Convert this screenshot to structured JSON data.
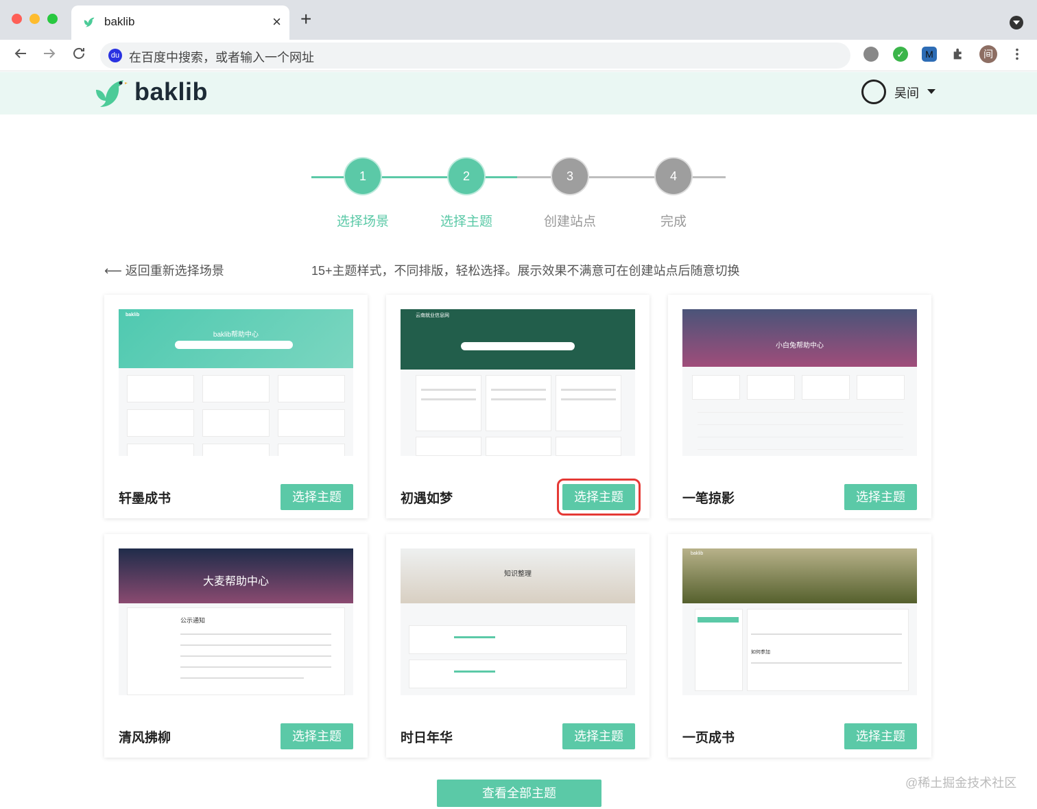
{
  "browser": {
    "tab_title": "baklib",
    "new_tab": "+",
    "close": "×",
    "omnibox_placeholder": "在百度中搜索，或者输入一个网址",
    "ext_m": "M",
    "ext_profile": "间"
  },
  "header": {
    "logo": "baklib",
    "user_name": "吴间"
  },
  "steps": [
    {
      "num": "1",
      "label": "选择场景",
      "state": "done"
    },
    {
      "num": "2",
      "label": "选择主题",
      "state": "current"
    },
    {
      "num": "3",
      "label": "创建站点",
      "state": "todo"
    },
    {
      "num": "4",
      "label": "完成",
      "state": "todo"
    }
  ],
  "back_link": "⟵ 返回重新选择场景",
  "hint": "15+主题样式，不同排版，轻松选择。展示效果不满意可在创建站点后随意切换",
  "select_label": "选择主题",
  "themes": [
    {
      "name": "轩墨成书",
      "preview_title": "baklib帮助中心",
      "preview_brand": "baklib"
    },
    {
      "name": "初遇如梦",
      "preview_title": "云南就业信息网"
    },
    {
      "name": "一笔掠影",
      "preview_title": "小白兔帮助中心"
    },
    {
      "name": "清风拂柳",
      "preview_title": "大麦帮助中心",
      "preview_subtitle": "公示通知"
    },
    {
      "name": "时日年华",
      "preview_title": "知识整理"
    },
    {
      "name": "一页成书",
      "preview_title": "如何参加",
      "preview_brand": "baklib"
    }
  ],
  "view_all": "查看全部主题",
  "watermark": "@稀土掘金技术社区",
  "colors": {
    "accent": "#5bc9a7",
    "focus_outline": "#e53935",
    "inactive_step": "#9e9e9e"
  }
}
